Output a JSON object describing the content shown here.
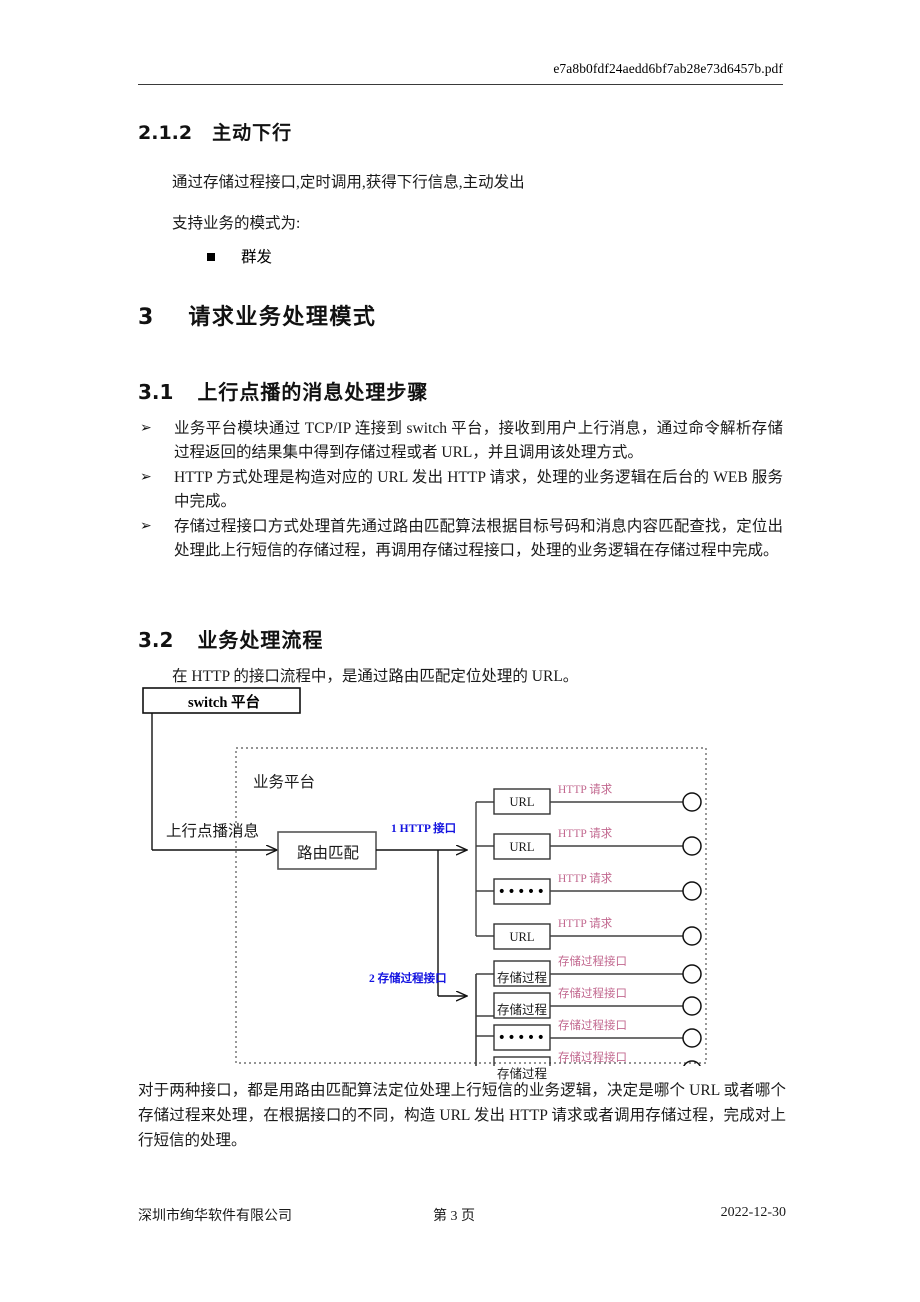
{
  "header": {
    "filename": "e7a8b0fdf24aedd6bf7ab28e73d6457b.pdf"
  },
  "sections": {
    "s212": {
      "number": "2.1.2",
      "title": "主动下行"
    },
    "s3": {
      "number": "3",
      "title": "请求业务处理模式"
    },
    "s31": {
      "number": "3.1",
      "title": "上行点播的消息处理步骤"
    },
    "s32": {
      "number": "3.2",
      "title": "业务处理流程"
    }
  },
  "body": {
    "p1": "通过存储过程接口,定时调用,获得下行信息,主动发出",
    "p2": "支持业务的模式为:",
    "bullet1": "群发",
    "arrow_items": [
      "业务平台模块通过 TCP/IP 连接到 switch 平台，接收到用户上行消息，通过命令解析存储过程返回的结果集中得到存储过程或者 URL，并且调用该处理方式。",
      "HTTP 方式处理是构造对应的 URL 发出 HTTP 请求，处理的业务逻辑在后台的 WEB 服务中完成。",
      "存储过程接口方式处理首先通过路由匹配算法根据目标号码和消息内容匹配查找，定位出处理此上行短信的存储过程，再调用存储过程接口，处理的业务逻辑在存储过程中完成。"
    ],
    "arrow_marker": "➢",
    "flow_intro": "在 HTTP 的接口流程中，是通过路由匹配定位处理的 URL。",
    "closing": "对于两种接口，都是用路由匹配算法定位处理上行短信的业务逻辑，决定是哪个 URL 或者哪个存储过程来处理，在根据接口的不同，构造 URL 发出 HTTP 请求或者调用存储过程，完成对上行短信的处理。"
  },
  "diagram": {
    "switch_box": "switch 平台",
    "platform_label": "业务平台",
    "inbound_label": "上行点播消息",
    "route_box": "路由匹配",
    "interface1": "1 HTTP 接口",
    "interface2": "2  存储过程接口",
    "http_branch": {
      "nodes": [
        "URL",
        "URL",
        "•••••",
        "URL"
      ],
      "labels": [
        "HTTP 请求",
        "HTTP 请求",
        "HTTP 请求",
        "HTTP 请求"
      ]
    },
    "proc_branch": {
      "nodes": [
        "存储过程",
        "存储过程",
        "•••••",
        "存储过程"
      ],
      "labels": [
        "存储过程接口",
        "存储过程接口",
        "存储过程接口",
        "存储过程接口"
      ]
    },
    "colors": {
      "interface_label": "#1313e0",
      "endpoint_label": "#c2688f",
      "line": "#404040"
    }
  },
  "footer": {
    "company": "深圳市绚华软件有限公司",
    "page": "第 3 页",
    "date": "2022-12-30"
  }
}
